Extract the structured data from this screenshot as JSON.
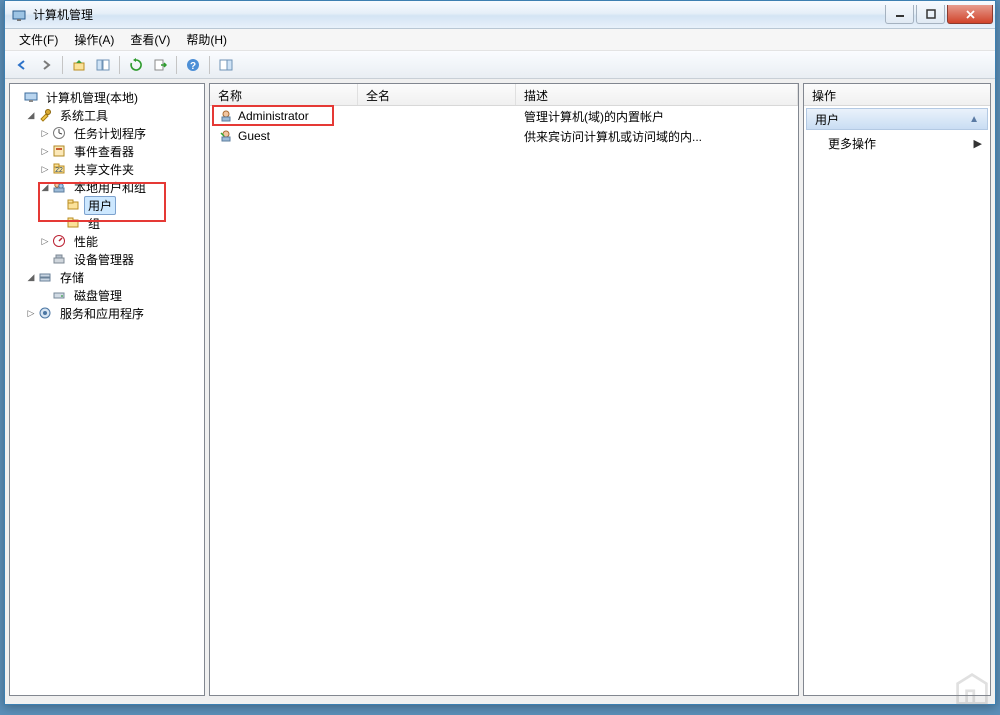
{
  "window": {
    "title": "计算机管理"
  },
  "menu": {
    "file": "文件(F)",
    "action": "操作(A)",
    "view": "查看(V)",
    "help": "帮助(H)"
  },
  "tree": {
    "root": "计算机管理(本地)",
    "system_tools": "系统工具",
    "task_scheduler": "任务计划程序",
    "event_viewer": "事件查看器",
    "shared_folders": "共享文件夹",
    "local_users_groups": "本地用户和组",
    "users": "用户",
    "groups": "组",
    "performance": "性能",
    "device_manager": "设备管理器",
    "storage": "存储",
    "disk_management": "磁盘管理",
    "services_apps": "服务和应用程序"
  },
  "list": {
    "columns": {
      "name": "名称",
      "fullname": "全名",
      "description": "描述"
    },
    "rows": [
      {
        "name": "Administrator",
        "fullname": "",
        "description": "管理计算机(域)的内置帐户"
      },
      {
        "name": "Guest",
        "fullname": "",
        "description": "供来宾访问计算机或访问域的内..."
      }
    ]
  },
  "actions": {
    "header": "操作",
    "section_title": "用户",
    "more_actions": "更多操作"
  },
  "toolbar_icons": [
    "back-icon",
    "forward-icon",
    "up-icon",
    "show-hide-icon",
    "refresh-icon",
    "export-icon",
    "help-icon",
    "properties-icon"
  ]
}
